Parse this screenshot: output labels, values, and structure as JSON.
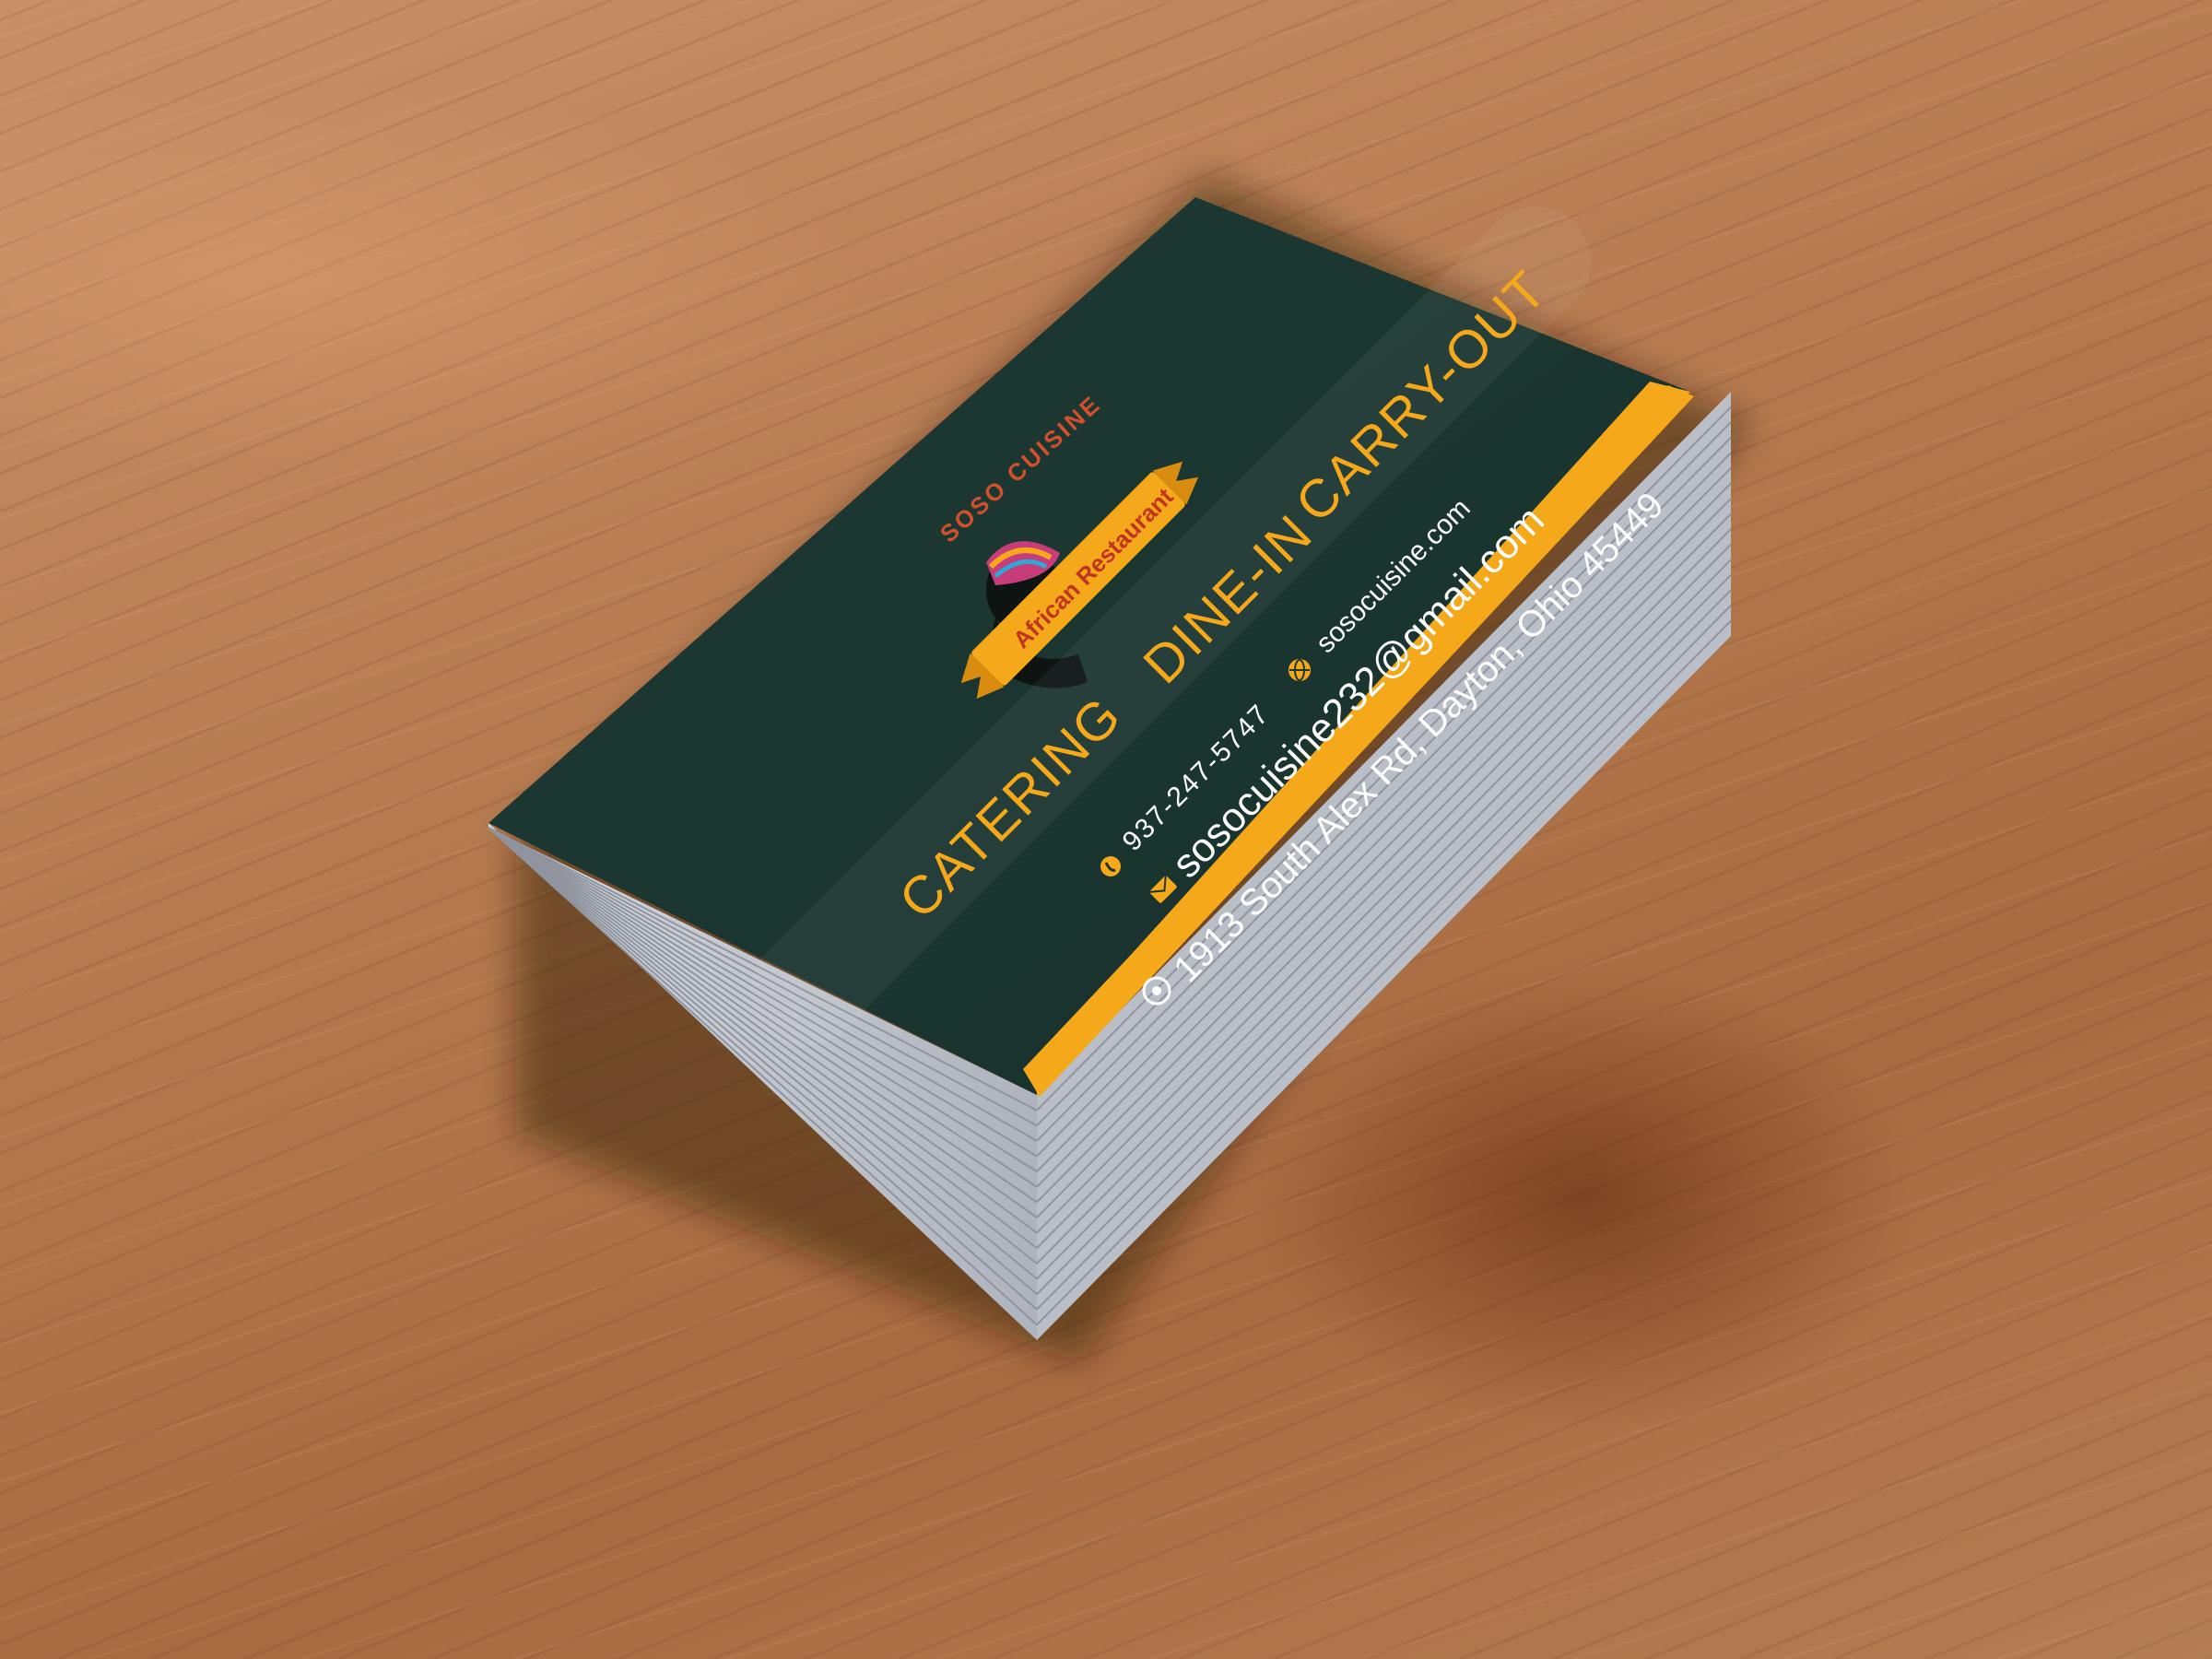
{
  "card": {
    "brand": "SOSO CUISINE",
    "banner": "African Restaurant",
    "services": [
      "CATERING",
      "DINE-IN",
      "CARRY-OUT"
    ],
    "phone": "937-247-5747",
    "website": "sosocuisine.com",
    "email": "sosocuisine232@gmail.com",
    "address": "1913 South Alex Rd, Dayton, Ohio 45449"
  },
  "colors": {
    "card_face": "#1c3530",
    "accent": "#f4a81a",
    "brand_text": "#d2502a",
    "paper_edge": "#c9ccd3",
    "wood": "#b47a4c"
  },
  "icons": {
    "phone": "phone-icon",
    "web": "globe-icon",
    "mail": "mail-icon",
    "address": "location-pin-icon"
  }
}
